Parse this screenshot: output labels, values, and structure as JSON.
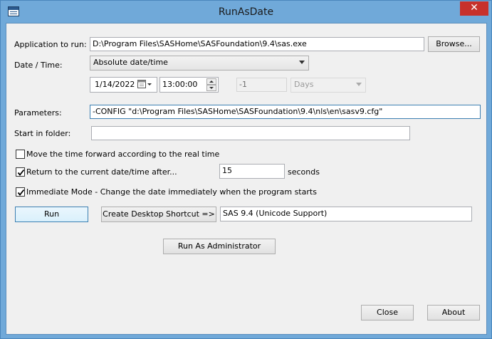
{
  "window": {
    "title": "RunAsDate",
    "close_glyph": "✕"
  },
  "app": {
    "label": "Application to run:",
    "value": "D:\\Program Files\\SASHome\\SASFoundation\\9.4\\sas.exe",
    "browse_label": "Browse..."
  },
  "datetime": {
    "label": "Date / Time:",
    "mode": "Absolute date/time",
    "date": "1/14/2022",
    "time": "13:00:00",
    "offset": "-1",
    "unit": "Days"
  },
  "params": {
    "label": "Parameters:",
    "value": "-CONFIG \"d:\\Program Files\\SASHome\\SASFoundation\\9.4\\nls\\en\\sasv9.cfg\""
  },
  "startin": {
    "label": "Start in folder:",
    "value": ""
  },
  "options": {
    "move_forward": {
      "label": "Move the time forward according to the real time",
      "checked": false
    },
    "return_after": {
      "label": "Return to the current date/time after...",
      "checked": true,
      "seconds": "15",
      "unit_label": "seconds"
    },
    "immediate": {
      "label": "Immediate Mode - Change the date immediately when the program starts",
      "checked": true
    }
  },
  "actions": {
    "run_label": "Run",
    "shortcut_label": "Create Desktop Shortcut =>",
    "shortcut_name": "SAS 9.4 (Unicode Support)",
    "run_admin_label": "Run As Administrator",
    "close_label": "Close",
    "about_label": "About"
  }
}
